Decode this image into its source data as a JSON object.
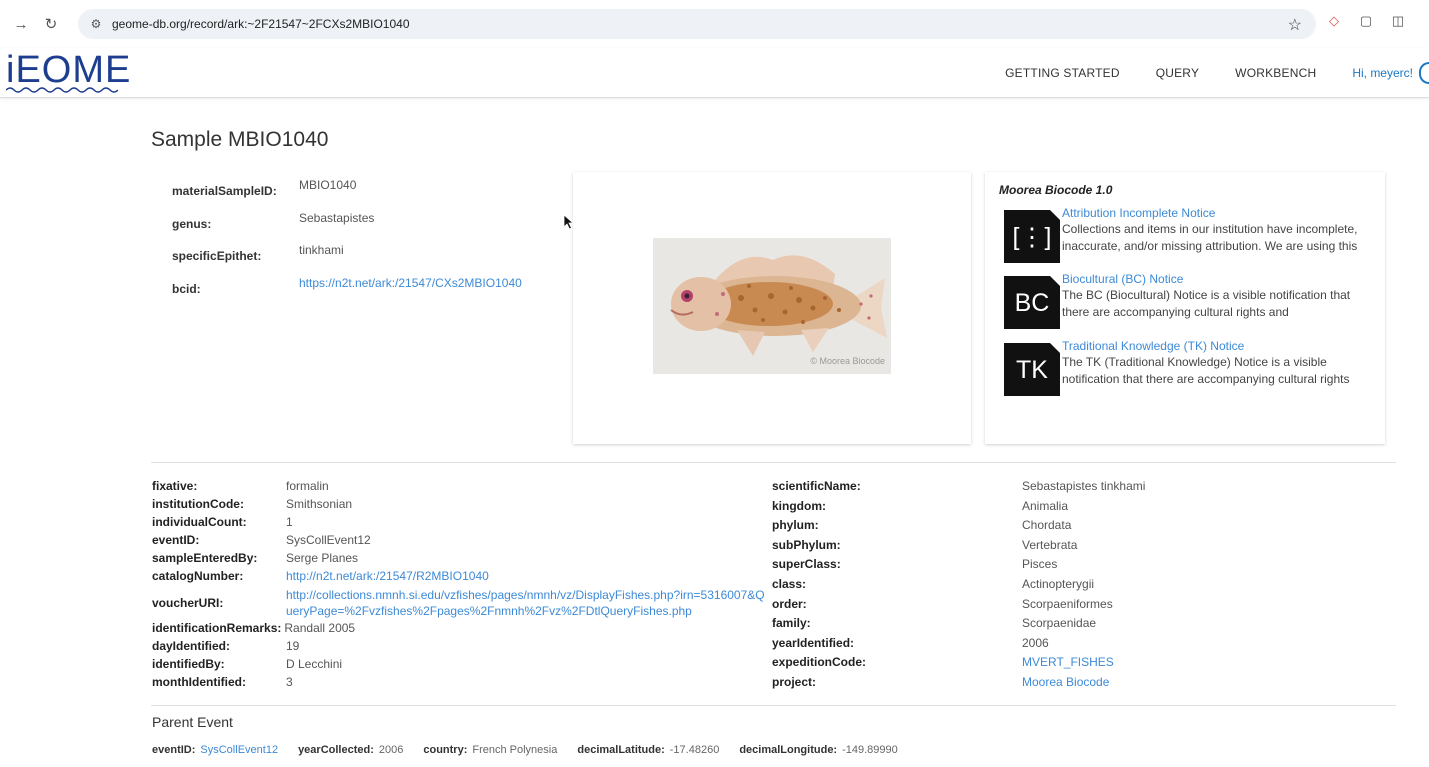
{
  "browser": {
    "url": "geome-db.org/record/ark:~2F21547~2FCXs2MBIO1040"
  },
  "header": {
    "logo": "iEOME",
    "nav": [
      "GETTING STARTED",
      "QUERY",
      "WORKBENCH"
    ],
    "user": "Hi, meyerc!"
  },
  "page": {
    "title": "Sample MBIO1040"
  },
  "top_fields": [
    {
      "label": "materialSampleID:",
      "value": "MBIO1040"
    },
    {
      "label": "genus:",
      "value": "Sebastapistes"
    },
    {
      "label": "specificEpithet:",
      "value": "tinkhami"
    },
    {
      "label": "bcid:",
      "value": "https://n2t.net/ark:/21547/CXs2MBIO1040"
    }
  ],
  "image": {
    "credit": "© Moorea Biocode"
  },
  "notices": {
    "title": "Moorea Biocode 1.0",
    "items": [
      {
        "badge": "[⋮]",
        "name": "Attribution Incomplete Notice",
        "desc": "Collections and items in our institution have incomplete, inaccurate, and/or missing attribution. We are using this"
      },
      {
        "badge": "BC",
        "name": "Biocultural (BC) Notice",
        "desc": "The BC (Biocultural) Notice is a visible notification that there are accompanying cultural rights and"
      },
      {
        "badge": "TK",
        "name": "Traditional Knowledge (TK) Notice",
        "desc": "The TK (Traditional Knowledge) Notice is a visible notification that there are accompanying cultural rights"
      }
    ]
  },
  "details_left": [
    {
      "label": "fixative:",
      "value": "formalin"
    },
    {
      "label": "institutionCode:",
      "value": "Smithsonian"
    },
    {
      "label": "individualCount:",
      "value": "1"
    },
    {
      "label": "eventID:",
      "value": "SysCollEvent12"
    },
    {
      "label": "sampleEnteredBy:",
      "value": "Serge Planes"
    },
    {
      "label": "catalogNumber:",
      "value": "http://n2t.net/ark:/21547/R2MBIO1040"
    },
    {
      "label": "voucherURI:",
      "value": "http://collections.nmnh.si.edu/vzfishes/pages/nmnh/vz/DisplayFishes.php?irn=5316007&QueryPage=%2Fvzfishes%2Fpages%2Fnmnh%2Fvz%2FDtlQueryFishes.php"
    },
    {
      "label": "identificationRemarks:",
      "value": "Randall 2005"
    },
    {
      "label": "dayIdentified:",
      "value": "19"
    },
    {
      "label": "identifiedBy:",
      "value": "D Lecchini"
    },
    {
      "label": "monthIdentified:",
      "value": "3"
    }
  ],
  "details_right": [
    {
      "label": "scientificName:",
      "value": "Sebastapistes tinkhami"
    },
    {
      "label": "kingdom:",
      "value": "Animalia"
    },
    {
      "label": "phylum:",
      "value": "Chordata"
    },
    {
      "label": "subPhylum:",
      "value": "Vertebrata"
    },
    {
      "label": "superClass:",
      "value": "Pisces"
    },
    {
      "label": "class:",
      "value": "Actinopterygii"
    },
    {
      "label": "order:",
      "value": "Scorpaeniformes"
    },
    {
      "label": "family:",
      "value": "Scorpaenidae"
    },
    {
      "label": "yearIdentified:",
      "value": "2006"
    },
    {
      "label": "expeditionCode:",
      "value": "MVERT_FISHES"
    },
    {
      "label": "project:",
      "value": "Moorea Biocode"
    }
  ],
  "parent_event": {
    "title": "Parent Event",
    "fields": [
      {
        "label": "eventID:",
        "value": "SysCollEvent12"
      },
      {
        "label": "yearCollected:",
        "value": "2006"
      },
      {
        "label": "country:",
        "value": "French Polynesia"
      },
      {
        "label": "decimalLatitude:",
        "value": "-17.48260"
      },
      {
        "label": "decimalLongitude:",
        "value": "-149.89990"
      }
    ]
  },
  "colors": {
    "link": "#3d8ad6",
    "logo": "#1d3e8f",
    "user": "#1e78c2"
  }
}
